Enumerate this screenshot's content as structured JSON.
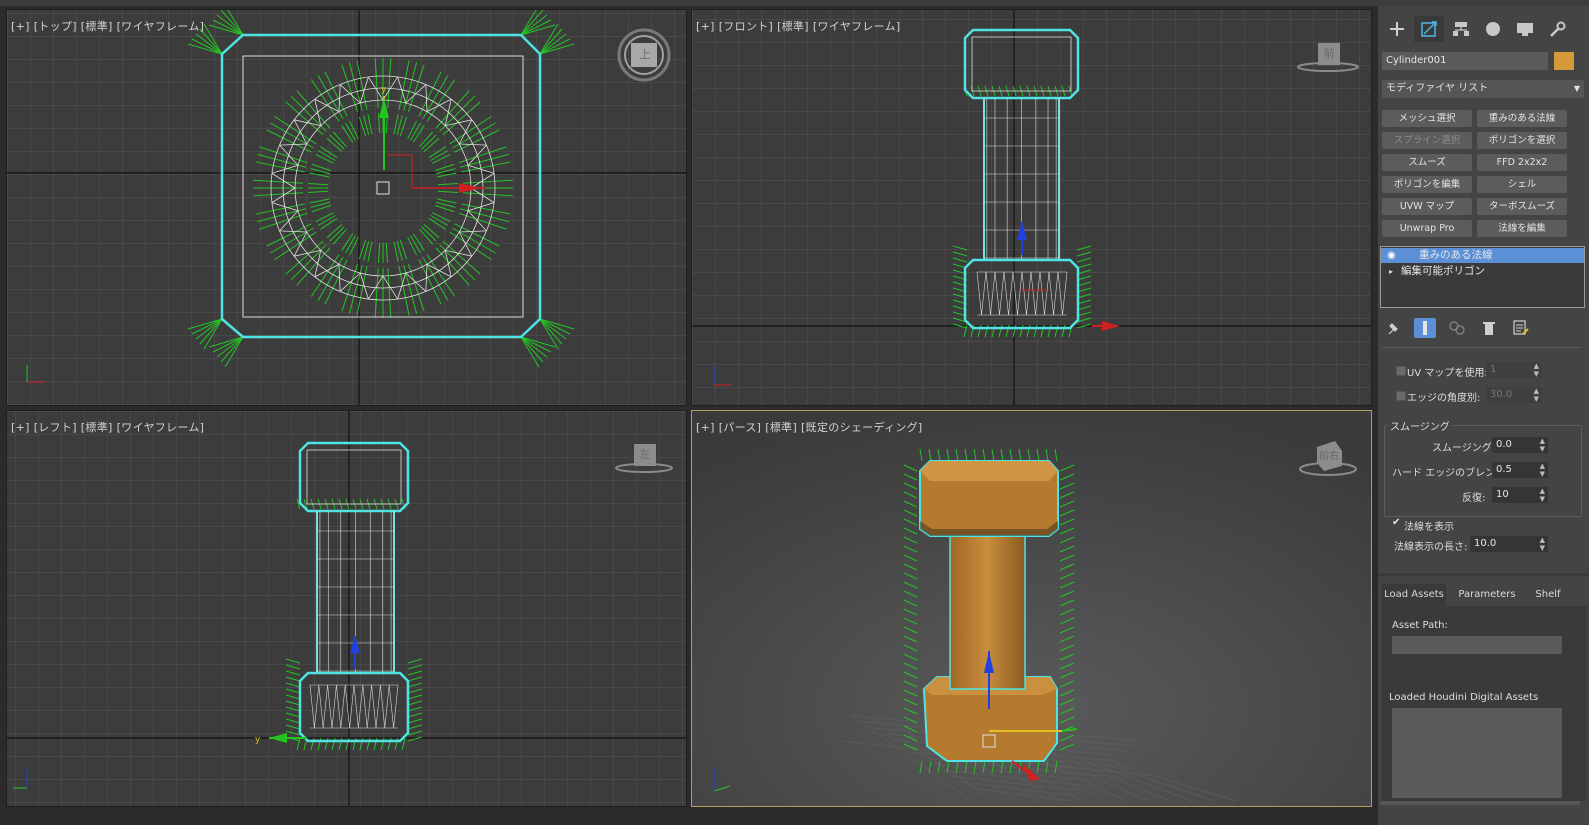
{
  "viewports": {
    "top": {
      "label": [
        "[+]",
        "[トップ]",
        "[標準]",
        "[ワイヤフレーム]"
      ],
      "cube": "上"
    },
    "front": {
      "label": [
        "[+]",
        "[フロント]",
        "[標準]",
        "[ワイヤフレーム]"
      ],
      "cube": "前"
    },
    "left": {
      "label": [
        "[+]",
        "[レフト]",
        "[標準]",
        "[ワイヤフレーム]"
      ],
      "cube": "左"
    },
    "persp": {
      "label": [
        "[+]",
        "[パース]",
        "[標準]",
        "[既定のシェーディング]"
      ],
      "cube": "前右"
    }
  },
  "axes": {
    "x": "x",
    "y": "y",
    "z": "z"
  },
  "panel": {
    "object_name": "Cylinder001",
    "object_color": "#d49a3a",
    "modifier_list": "モディファイヤ リスト",
    "buttons": [
      {
        "label": "メッシュ選択",
        "enabled": true
      },
      {
        "label": "重みのある法線",
        "enabled": true
      },
      {
        "label": "スプライン選択",
        "enabled": false
      },
      {
        "label": "ポリゴンを選択",
        "enabled": true
      },
      {
        "label": "スムーズ",
        "enabled": true
      },
      {
        "label": "FFD 2x2x2",
        "enabled": true
      },
      {
        "label": "ポリゴンを編集",
        "enabled": true
      },
      {
        "label": "シェル",
        "enabled": true
      },
      {
        "label": "UVW マップ",
        "enabled": true
      },
      {
        "label": "ターボスムーズ",
        "enabled": true
      },
      {
        "label": "Unwrap Pro",
        "enabled": true
      },
      {
        "label": "法線を編集",
        "enabled": true
      }
    ],
    "stack": [
      {
        "label": "重みのある法線",
        "selected": true
      },
      {
        "label": "編集可能ポリゴン",
        "selected": false
      }
    ],
    "params": {
      "use_uv_map_label": "UV マップを使用:",
      "use_uv_map_value": "1",
      "edge_angle_label": "エッジの角度別:",
      "edge_angle_value": "30.0",
      "smoothing_group": "スムージング",
      "smoothing_label": "スムージング:",
      "smoothing_value": "0.0",
      "hard_blend_label": "ハード エッジのブレンド:",
      "hard_blend_value": "0.5",
      "iterations_label": "反復:",
      "iterations_value": "10",
      "show_normals_label": "法線を表示",
      "show_normals_checked": true,
      "normal_length_label": "法線表示の長さ:",
      "normal_length_value": "10.0"
    },
    "houdini_tabs": [
      "Load Assets",
      "Parameters",
      "Shelf"
    ],
    "asset_path_label": "Asset Path:",
    "loaded_assets_label": "Loaded Houdini Digital Assets"
  },
  "colors": {
    "selection": "#4fe3e3",
    "normals": "#22c522",
    "grid_bg": "#3c3c3c",
    "grid_line": "#575757",
    "object": "#b87a2e"
  }
}
